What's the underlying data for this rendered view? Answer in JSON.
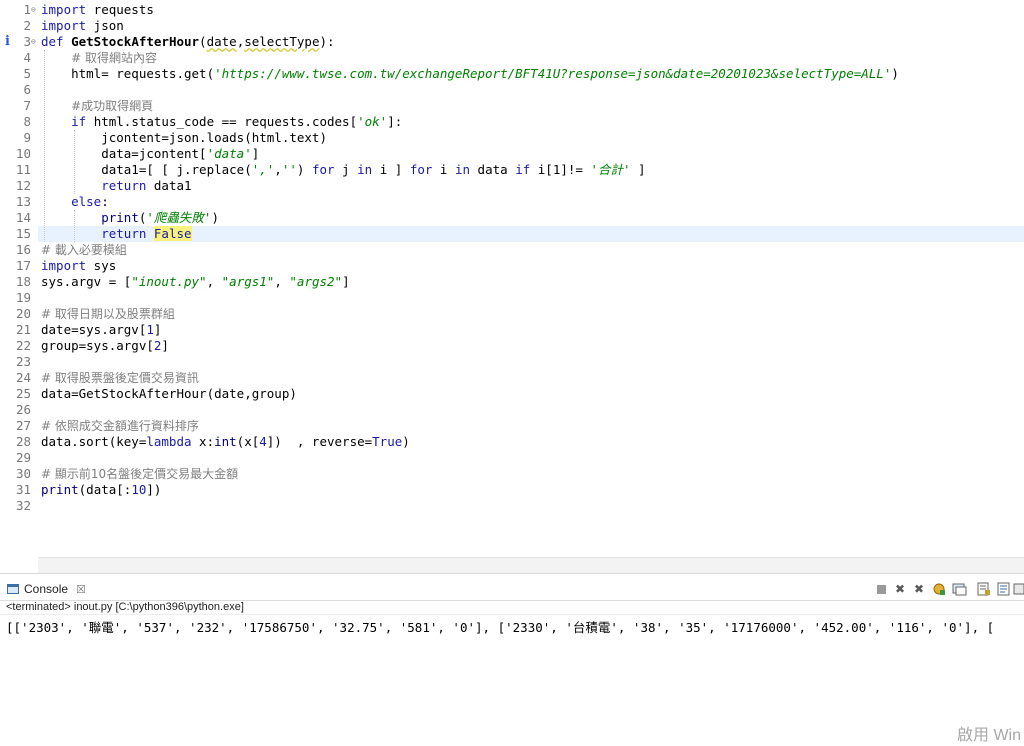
{
  "editor": {
    "line_numbers": [
      "1",
      "2",
      "3",
      "4",
      "5",
      "6",
      "7",
      "8",
      "9",
      "10",
      "11",
      "12",
      "13",
      "14",
      "15",
      "16",
      "17",
      "18",
      "19",
      "20",
      "21",
      "22",
      "23",
      "24",
      "25",
      "26",
      "27",
      "28",
      "29",
      "30",
      "31",
      "32"
    ],
    "info_marker": "i",
    "fold_glyph": "⊖",
    "current_line": 15,
    "lines": [
      [
        {
          "t": "import",
          "c": "k"
        },
        {
          "t": " requests"
        }
      ],
      [
        {
          "t": "import",
          "c": "k"
        },
        {
          "t": " json"
        }
      ],
      [
        {
          "t": "def",
          "c": "k"
        },
        {
          "t": " "
        },
        {
          "t": "GetStockAfterHour",
          "c": "b"
        },
        {
          "t": "("
        },
        {
          "t": "date",
          "c": "squig"
        },
        {
          "t": ","
        },
        {
          "t": "selectType",
          "c": "squig"
        },
        {
          "t": "):"
        }
      ],
      [
        {
          "t": "    "
        },
        {
          "t": "# 取得網站內容",
          "c": "cm"
        }
      ],
      [
        {
          "t": "    html= requests.get("
        },
        {
          "t": "'https://www.twse.com.tw/exchangeReport/BFT41U?response=json&date=20201023&selectType=ALL'",
          "c": "s"
        },
        {
          "t": ")"
        }
      ],
      [],
      [
        {
          "t": "    "
        },
        {
          "t": "#成功取得網頁",
          "c": "cm"
        }
      ],
      [
        {
          "t": "    "
        },
        {
          "t": "if",
          "c": "k"
        },
        {
          "t": " html.status_code == requests.codes["
        },
        {
          "t": "'ok'",
          "c": "s"
        },
        {
          "t": "]:"
        }
      ],
      [
        {
          "t": "        jcontent=json.loads(html.text)"
        }
      ],
      [
        {
          "t": "        data=jcontent["
        },
        {
          "t": "'data'",
          "c": "s"
        },
        {
          "t": "]"
        }
      ],
      [
        {
          "t": "        data1=[ [ j.replace("
        },
        {
          "t": "','",
          "c": "s"
        },
        {
          "t": ","
        },
        {
          "t": "''",
          "c": "s"
        },
        {
          "t": ") "
        },
        {
          "t": "for",
          "c": "k"
        },
        {
          "t": " j "
        },
        {
          "t": "in",
          "c": "k"
        },
        {
          "t": " i ] "
        },
        {
          "t": "for",
          "c": "k"
        },
        {
          "t": " i "
        },
        {
          "t": "in",
          "c": "k"
        },
        {
          "t": " data "
        },
        {
          "t": "if",
          "c": "k"
        },
        {
          "t": " i[1]!= "
        },
        {
          "t": "'合計'",
          "c": "s"
        },
        {
          "t": " ]"
        }
      ],
      [
        {
          "t": "        "
        },
        {
          "t": "return",
          "c": "k"
        },
        {
          "t": " data1"
        }
      ],
      [
        {
          "t": "    "
        },
        {
          "t": "else",
          "c": "k"
        },
        {
          "t": ":"
        }
      ],
      [
        {
          "t": "        "
        },
        {
          "t": "print",
          "c": "bi"
        },
        {
          "t": "("
        },
        {
          "t": "'爬蟲失敗'",
          "c": "s"
        },
        {
          "t": ")"
        }
      ],
      [
        {
          "t": "        "
        },
        {
          "t": "return",
          "c": "k"
        },
        {
          "t": " "
        },
        {
          "t": "False",
          "c": "false-hl"
        }
      ],
      [
        {
          "t": "# 載入必要模組",
          "c": "cm"
        }
      ],
      [
        {
          "t": "import",
          "c": "k"
        },
        {
          "t": " sys"
        }
      ],
      [
        {
          "t": "sys.argv = ["
        },
        {
          "t": "\"inout.py\"",
          "c": "s"
        },
        {
          "t": ", "
        },
        {
          "t": "\"args1\"",
          "c": "s"
        },
        {
          "t": ", "
        },
        {
          "t": "\"args2\"",
          "c": "s"
        },
        {
          "t": "]"
        }
      ],
      [],
      [
        {
          "t": "# 取得日期以及股票群組",
          "c": "cm"
        }
      ],
      [
        {
          "t": "date=sys.argv["
        },
        {
          "t": "1",
          "c": "n"
        },
        {
          "t": "]"
        }
      ],
      [
        {
          "t": "group=sys.argv["
        },
        {
          "t": "2",
          "c": "n"
        },
        {
          "t": "]"
        }
      ],
      [],
      [
        {
          "t": "# 取得股票盤後定價交易資訊",
          "c": "cm"
        }
      ],
      [
        {
          "t": "data=GetStockAfterHour(date,group)"
        }
      ],
      [],
      [
        {
          "t": "# 依照成交金額進行資料排序",
          "c": "cm"
        }
      ],
      [
        {
          "t": "data.sort(key="
        },
        {
          "t": "lambda",
          "c": "k"
        },
        {
          "t": " x:"
        },
        {
          "t": "int",
          "c": "bi"
        },
        {
          "t": "(x["
        },
        {
          "t": "4",
          "c": "n"
        },
        {
          "t": "])  , reverse="
        },
        {
          "t": "True",
          "c": "k"
        },
        {
          "t": ")"
        }
      ],
      [],
      [
        {
          "t": "# 顯示前10名盤後定價交易最大金額",
          "c": "cm"
        }
      ],
      [
        {
          "t": "print",
          "c": "bi"
        },
        {
          "t": "(data[:"
        },
        {
          "t": "10",
          "c": "n"
        },
        {
          "t": "])"
        }
      ],
      []
    ]
  },
  "console": {
    "tab_label": "Console",
    "tab_close": "☒",
    "status": "<terminated> inout.py [C:\\python396\\python.exe]",
    "output": "[['2303', '聯電', '537', '232', '17586750', '32.75', '581', '0'], ['2330', '台積電', '38', '35', '17176000', '452.00', '116', '0'], ["
  },
  "toolbar_icons": [
    "stop-icon",
    "remove-launch-icon",
    "remove-all-icon",
    "pin-icon",
    "display-console-icon",
    "scroll-lock-icon",
    "word-wrap-icon",
    "open-console-icon"
  ],
  "watermark": "啟用 Win"
}
